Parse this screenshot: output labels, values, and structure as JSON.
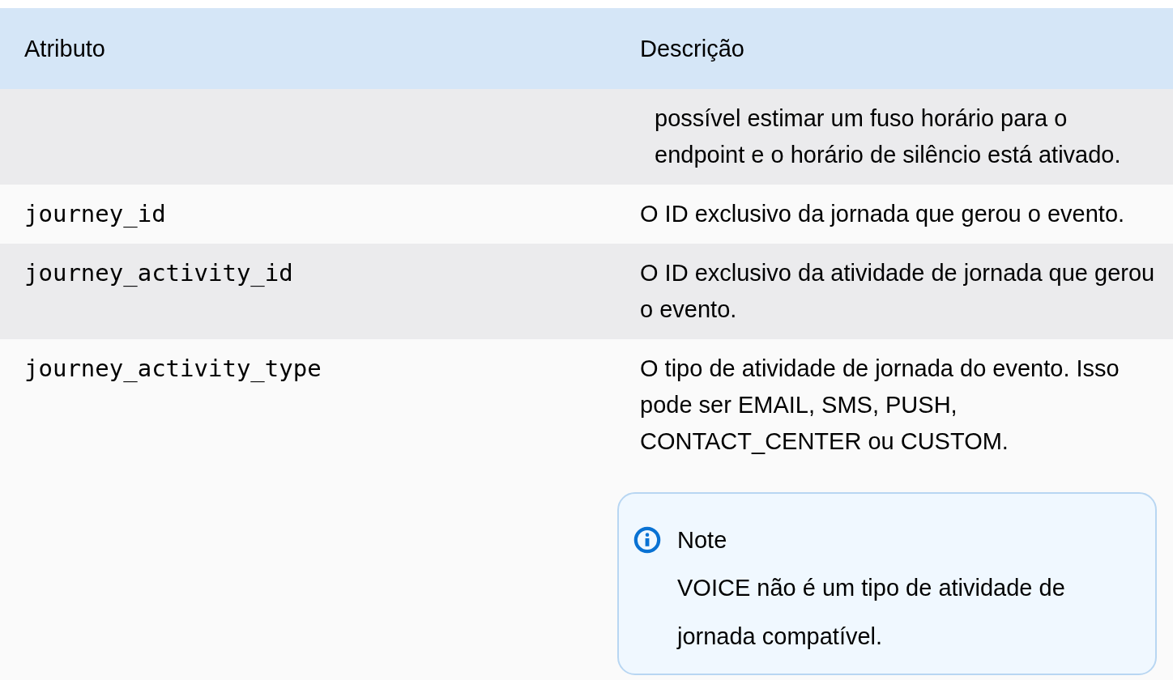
{
  "table": {
    "columns": [
      "Atributo",
      "Descrição"
    ],
    "rows": [
      {
        "attribute": "",
        "description": "possível estimar um fuso horário para o endpoint e o horário de silêncio está ativado.",
        "continued": true
      },
      {
        "attribute": "journey_id",
        "description": "O ID exclusivo da jornada que gerou o evento.",
        "continued": false
      },
      {
        "attribute": "journey_activity_id",
        "description": "O ID exclusivo da atividade de jornada que gerou o evento.",
        "continued": false
      },
      {
        "attribute": "journey_activity_type",
        "description": "O tipo de atividade de jornada do evento. Isso pode ser EMAIL, SMS, PUSH, CONTACT_CENTER ou CUSTOM.",
        "continued": false,
        "note": {
          "title": "Note",
          "text": "VOICE não é um tipo de atividade de jornada compatível."
        }
      }
    ]
  }
}
